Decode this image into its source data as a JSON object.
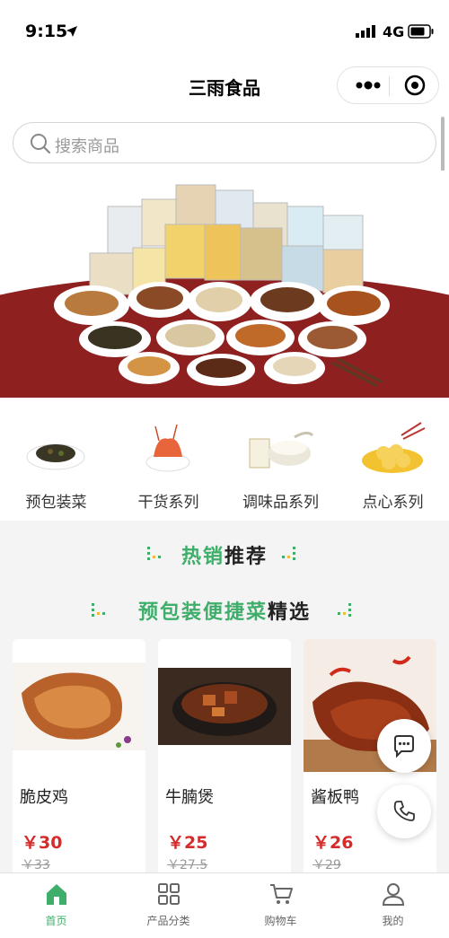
{
  "status_bar": {
    "time": "9:15",
    "network": "4G"
  },
  "nav": {
    "title": "三雨食品"
  },
  "search": {
    "placeholder": "搜索商品"
  },
  "categories": [
    {
      "label": "预包装菜",
      "icon": "packaged-dish-icon"
    },
    {
      "label": "干货系列",
      "icon": "dried-shrimp-icon"
    },
    {
      "label": "调味品系列",
      "icon": "seasoning-icon"
    },
    {
      "label": "点心系列",
      "icon": "dim-sum-icon"
    }
  ],
  "sections": {
    "hot": {
      "accent": "热销",
      "dark": "推荐"
    },
    "featured": {
      "accent": "预包装便捷菜",
      "dark": "精选"
    }
  },
  "products": [
    {
      "name": "脆皮鸡",
      "price": "￥30",
      "old_price": "￥33"
    },
    {
      "name": "牛腩煲",
      "price": "￥25",
      "old_price": "￥27.5"
    },
    {
      "name": "酱板鸭",
      "price": "￥26",
      "old_price": "￥29"
    }
  ],
  "tabs": [
    {
      "label": "首页",
      "icon": "home-icon",
      "active": true
    },
    {
      "label": "产品分类",
      "icon": "grid-icon",
      "active": false
    },
    {
      "label": "购物车",
      "icon": "cart-icon",
      "active": false
    },
    {
      "label": "我的",
      "icon": "user-icon",
      "active": false
    }
  ],
  "colors": {
    "accent": "#3fae6a",
    "price": "#d62b2b",
    "banner_red": "#8e2020"
  }
}
